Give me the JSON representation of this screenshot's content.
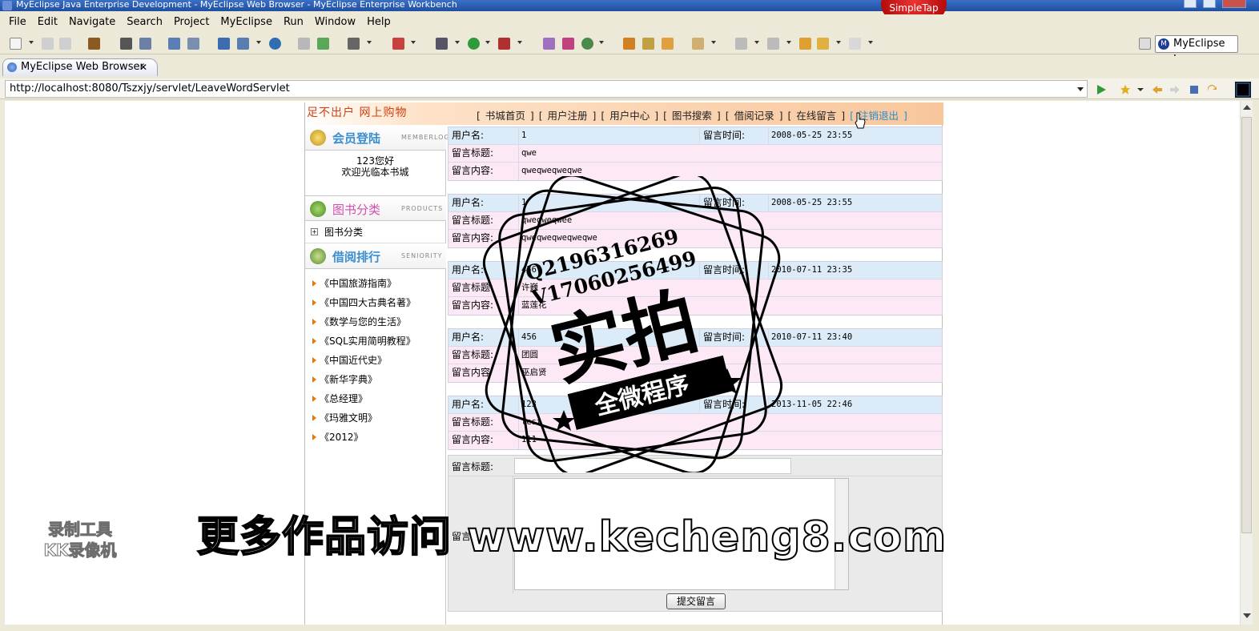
{
  "window": {
    "title": "MyEclipse Java Enterprise Development - MyEclipse Web Browser - MyEclipse Enterprise Workbench",
    "overlay_badge": "SimpleTap"
  },
  "menu": [
    "File",
    "Edit",
    "Navigate",
    "Search",
    "Project",
    "MyEclipse",
    "Run",
    "Window",
    "Help"
  ],
  "perspective": {
    "label": "MyEclipse J...",
    "icon": "M"
  },
  "browser_tab": {
    "label": "MyEclipse Web Browser",
    "close": "✕"
  },
  "url": "http://localhost:8080/Tszxjy/servlet/LeaveWordServlet",
  "site": {
    "slogan": "足不出户 网上购物",
    "nav": [
      "[ 书城首页 ]",
      "[ 用户注册 ]",
      "[ 用户中心 ]",
      "[ 图书搜索 ]",
      "[ 借阅记录 ]",
      "[ 在线留言 ]",
      "[ 注销退出 ]"
    ],
    "login_title": "会员登陆",
    "login_en": "MEMBERLOGIN",
    "welcome_line1": "123您好",
    "welcome_line2": "欢迎光临本书城",
    "category_title": "图书分类",
    "category_en": "PRODUCTS",
    "category_item": "图书分类",
    "ranking_title": "借阅排行",
    "ranking_en": "SENIORITY",
    "ranking": [
      "《中国旅游指南》",
      "《中国四大古典名著》",
      "《数学与您的生活》",
      "《SQL实用简明教程》",
      "《中国近代史》",
      "《新华字典》",
      "《总经理》",
      "《玛雅文明》",
      "《2012》"
    ]
  },
  "labels": {
    "user": "用户名:",
    "time": "留言时间:",
    "title": "留言标题:",
    "content": "留言内容:",
    "content_alt": "留言内容"
  },
  "messages": [
    {
      "user": "1",
      "time": "2008-05-25 23:55",
      "title": "qwe",
      "content": "qweqweqweqwe"
    },
    {
      "user": "1",
      "time": "2008-05-25 23:55",
      "title": "qweqweqwee",
      "content": "qweqweqweqweqwe"
    },
    {
      "user": "456",
      "time": "2010-07-11 23:35",
      "title": "许巍",
      "content": "蓝莲花"
    },
    {
      "user": "456",
      "time": "2010-07-11 23:40",
      "title": "团圆",
      "content": "巫启贤"
    },
    {
      "user": "123",
      "time": "2013-11-05 22:46",
      "title": "test",
      "content": "111"
    }
  ],
  "form": {
    "title_label": "留言标题:",
    "content_label": "留言",
    "submit": "提交留言"
  },
  "watermark": {
    "qq": "Q2196316269",
    "wechat": "V17060256499",
    "big": "实拍",
    "banner": "全微程序",
    "promo": "更多作品访问 www.kecheng8.com",
    "recorder_line1": "录制工具",
    "recorder_line2": "KK录像机"
  }
}
